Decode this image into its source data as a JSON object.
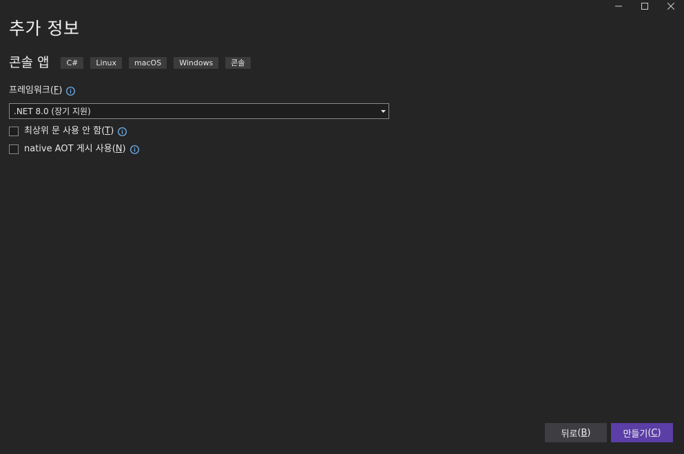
{
  "window": {
    "controls": {
      "minimize_icon": "minimize-icon",
      "maximize_icon": "maximize-icon",
      "close_icon": "close-icon"
    }
  },
  "page": {
    "title": "추가 정보"
  },
  "template": {
    "name": "콘솔 앱",
    "tags": [
      "C#",
      "Linux",
      "macOS",
      "Windows",
      "콘솔"
    ]
  },
  "framework": {
    "label": "프레임워크",
    "mnemonic": "F",
    "info_icon": "info-icon",
    "selected": ".NET 8.0 (장기 지원)"
  },
  "options": [
    {
      "label": "최상위 문 사용 안 함",
      "mnemonic": "T",
      "checked": false
    },
    {
      "label": "native AOT 게시 사용",
      "mnemonic": "N",
      "checked": false
    }
  ],
  "buttons": {
    "back_label": "뒤로",
    "back_mnemonic": "B",
    "create_label": "만들기",
    "create_mnemonic": "C"
  },
  "colors": {
    "background": "#252526",
    "accent": "#5b3ea6",
    "info": "#75beff",
    "tag_bg": "#3c3c3c"
  }
}
